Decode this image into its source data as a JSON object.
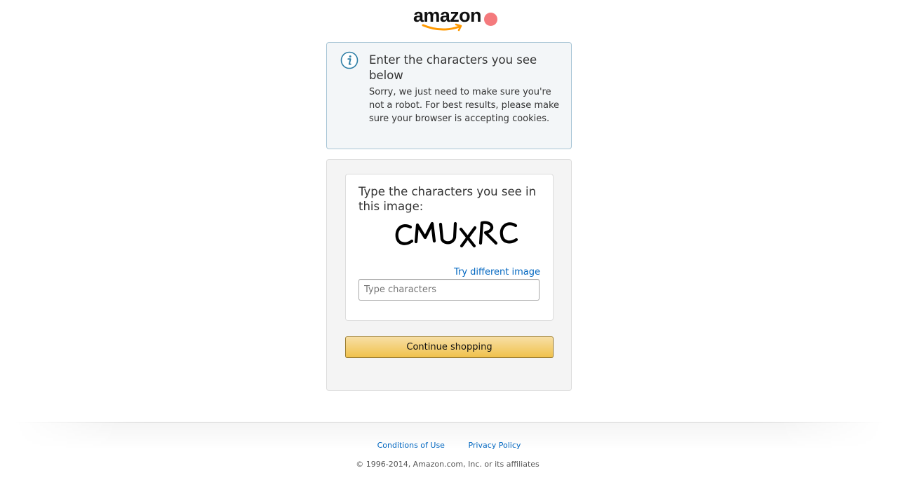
{
  "header": {
    "logo_text": "amazon",
    "logo_icon": "amazon-smile-logo"
  },
  "info": {
    "icon": "info-icon",
    "heading": "Enter the characters you see below",
    "message": "Sorry, we just need to make sure you're not a robot. For best results, please make sure your browser is accepting cookies."
  },
  "captcha": {
    "prompt": "Type the characters you see in this image:",
    "image_text": "CMUXRC",
    "try_different_label": "Try different image",
    "input_value": "",
    "input_placeholder": "Type characters",
    "submit_label": "Continue shopping"
  },
  "footer": {
    "links": [
      "Conditions of Use",
      "Privacy Policy"
    ],
    "copyright": "© 1996-2014, Amazon.com, Inc. or its affiliates"
  },
  "colors": {
    "link": "#0066c0",
    "button_gradient_top": "#f7dfa5",
    "button_gradient_bottom": "#f0c14b",
    "info_border": "#a9c6d6",
    "info_background": "#f3f6f8",
    "smile": "#ff9900",
    "cursor_marker": "#f47a7d"
  }
}
